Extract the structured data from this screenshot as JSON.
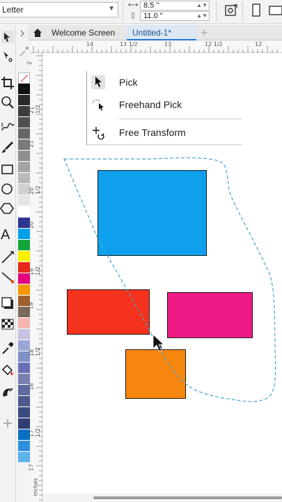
{
  "propbar": {
    "paper_size": "Letter",
    "width": "8.5 \"",
    "height": "11.0 \""
  },
  "tabs": {
    "welcome": "Welcome Screen",
    "document": "Untitled-1*"
  },
  "ruler": {
    "h_labels": [
      "14",
      "13 1/2",
      "13",
      "12 1/2",
      "12"
    ],
    "v_labels": [
      "2",
      "21 1/2",
      "21",
      "20 1/2",
      "20",
      "19 1/2",
      "19",
      "18 1/2",
      "18",
      "17 1/2",
      "17"
    ],
    "unit": "inches"
  },
  "flyout": {
    "items": [
      {
        "label": "Pick",
        "icon": "pick-arrow-icon"
      },
      {
        "label": "Freehand Pick",
        "icon": "freehand-pick-icon"
      },
      {
        "label": "Free Transform",
        "icon": "free-transform-icon"
      }
    ]
  },
  "palette": {
    "colors": [
      "#111111",
      "#2a2a2a",
      "#3d3d3d",
      "#505050",
      "#666666",
      "#7a7a7a",
      "#8f8f8f",
      "#a4a4a4",
      "#bababa",
      "#d0d0d0",
      "#e6e6e6",
      "#ffffff",
      "#2e3592",
      "#00a0e9",
      "#13a538",
      "#fff100",
      "#e8291c",
      "#e4007f",
      "#f39800",
      "#a05f2a",
      "#7a6a5a",
      "#f7b6b0",
      "#c7c2e0",
      "#9aa7d6",
      "#8090c9",
      "#6a6fb5",
      "#7a7fb0",
      "#5e6aa0",
      "#4b5a8f",
      "#3d4c80",
      "#2f3e70",
      "#0a6fc4",
      "#2f8fdc",
      "#5fb2ea"
    ]
  },
  "canvas": {
    "shapes": [
      {
        "name": "blue-rectangle",
        "color": "#0ea0ec"
      },
      {
        "name": "red-rectangle",
        "color": "#f4321d"
      },
      {
        "name": "pink-rectangle",
        "color": "#ee1b86"
      },
      {
        "name": "orange-rectangle",
        "color": "#f7860e"
      }
    ],
    "lasso_color": "#4aa6c9"
  }
}
